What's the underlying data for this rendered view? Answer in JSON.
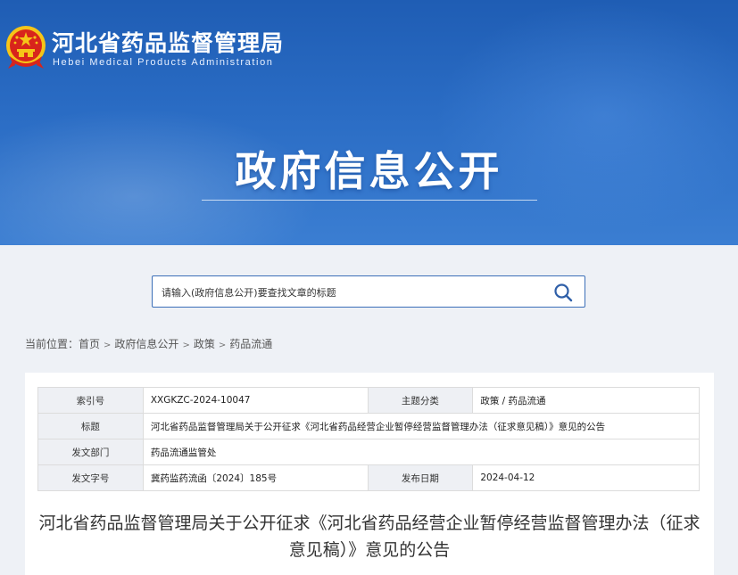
{
  "header": {
    "site_title": "河北省药品监督管理局",
    "site_subtitle": "Hebei Medical Products Administration",
    "hero_title": "政府信息公开"
  },
  "search": {
    "placeholder": "请输入(政府信息公开)要查找文章的标题"
  },
  "breadcrumb": {
    "prefix": "当前位置：",
    "items": [
      "首页",
      "政府信息公开",
      "政策",
      "药品流通"
    ],
    "separator": ">"
  },
  "meta": {
    "index_label": "索引号",
    "index_value": "XXGKZC-2024-10047",
    "category_label": "主题分类",
    "category_value": "政策 / 药品流通",
    "title_label": "标题",
    "title_value": "河北省药品监督管理局关于公开征求《河北省药品经营企业暂停经营监督管理办法（征求意见稿）》意见的公告",
    "dept_label": "发文部门",
    "dept_value": "药品流通监管处",
    "doc_no_label": "发文字号",
    "doc_no_value": "冀药监药流函〔2024〕185号",
    "date_label": "发布日期",
    "date_value": "2024-04-12"
  },
  "article": {
    "title": "河北省药品监督管理局关于公开征求《河北省药品经营企业暂停经营监督管理办法（征求意见稿）》意见的公告"
  },
  "colors": {
    "banner": "#2a6cc4",
    "search_border": "#3b6fb8",
    "emblem_red": "#d8241c",
    "emblem_gold": "#f5c518"
  }
}
